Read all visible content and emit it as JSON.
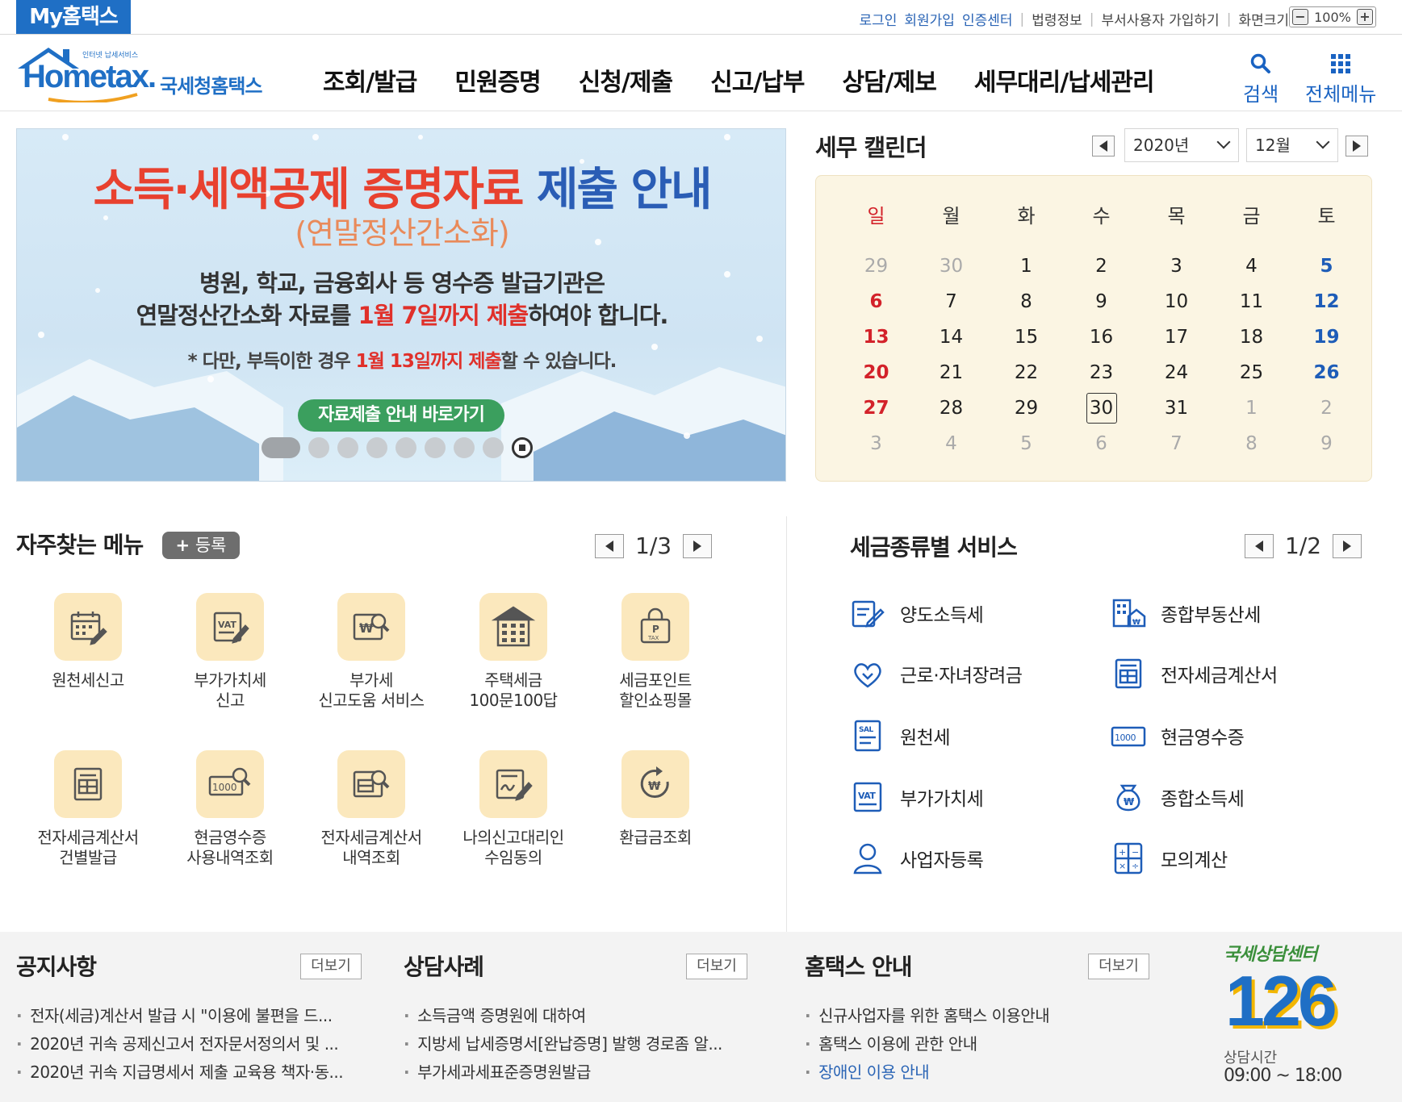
{
  "topbar": {
    "my_hometax": "My홈택스",
    "links": [
      {
        "label": "로그인",
        "style": "blue"
      },
      {
        "label": "회원가입",
        "style": "blue"
      },
      {
        "label": "인증센터",
        "style": "blue"
      },
      {
        "label": "법령정보",
        "style": "gray"
      },
      {
        "label": "부서사용자 가입하기",
        "style": "gray"
      },
      {
        "label": "화면크기",
        "style": "gray"
      }
    ],
    "zoom": "100%",
    "zoom_out": "−",
    "zoom_in": "+"
  },
  "header": {
    "logo_small": "인터넷 납세서비스",
    "logo_brand": "Hometax.",
    "logo_name": "국세청홈택스",
    "nav": [
      "조회/발급",
      "민원증명",
      "신청/제출",
      "신고/납부",
      "상담/제보",
      "세무대리/납세관리"
    ],
    "search_label": "검색",
    "allmenu_label": "전체메뉴"
  },
  "banner": {
    "title_red": "소득·세액공제 증명자료",
    "title_blue": "제출 안내",
    "subtitle": "(연말정산간소화)",
    "line1": "병원, 학교, 금융회사 등 영수증 발급기관은",
    "line2_a": "연말정산간소화 자료를 ",
    "line2_b": "1월 7일까지 제출",
    "line2_c": "하여야 합니다.",
    "note_a": "* 다만, 부득이한 경우 ",
    "note_b": "1월 13일까지 제출",
    "note_c": "할 수 있습니다.",
    "button": "자료제출 안내 바로가기"
  },
  "calendar": {
    "title": "세무 캘린더",
    "year": "2020년",
    "month": "12월",
    "weekdays": [
      "일",
      "월",
      "화",
      "수",
      "목",
      "금",
      "토"
    ],
    "weeks": [
      [
        "29",
        "30",
        "1",
        "2",
        "3",
        "4",
        "5"
      ],
      [
        "6",
        "7",
        "8",
        "9",
        "10",
        "11",
        "12"
      ],
      [
        "13",
        "14",
        "15",
        "16",
        "17",
        "18",
        "19"
      ],
      [
        "20",
        "21",
        "22",
        "23",
        "24",
        "25",
        "26"
      ],
      [
        "27",
        "28",
        "29",
        "30",
        "31",
        "1",
        "2"
      ],
      [
        "3",
        "4",
        "5",
        "6",
        "7",
        "8",
        "9"
      ]
    ],
    "today": "30"
  },
  "frequent": {
    "title": "자주찾는 메뉴",
    "add_label": "등록",
    "page": "1/3",
    "items": [
      {
        "label": "원천세신고",
        "icon": "calendar-edit-icon"
      },
      {
        "label": "부가가치세\n신고",
        "icon": "vat-form-icon"
      },
      {
        "label": "부가세\n신고도움 서비스",
        "icon": "won-search-icon"
      },
      {
        "label": "주택세금\n100문100답",
        "icon": "building-icon"
      },
      {
        "label": "세금포인트\n할인쇼핑몰",
        "icon": "shopping-bag-icon"
      },
      {
        "label": "전자세금계산서\n건별발급",
        "icon": "invoice-icon"
      },
      {
        "label": "현금영수증\n사용내역조회",
        "icon": "cash-receipt-search-icon"
      },
      {
        "label": "전자세금계산서\n내역조회",
        "icon": "invoice-search-icon"
      },
      {
        "label": "나의신고대리인\n수임동의",
        "icon": "sign-document-icon"
      },
      {
        "label": "환급금조회",
        "icon": "refund-icon"
      }
    ]
  },
  "tax_services": {
    "title": "세금종류별 서비스",
    "page": "1/2",
    "items": [
      {
        "label": "양도소득세",
        "icon": "transfer-tax-icon"
      },
      {
        "label": "종합부동산세",
        "icon": "real-estate-icon"
      },
      {
        "label": "근로·자녀장려금",
        "icon": "heart-hands-icon"
      },
      {
        "label": "전자세금계산서",
        "icon": "e-invoice-icon"
      },
      {
        "label": "원천세",
        "icon": "salary-icon"
      },
      {
        "label": "현금영수증",
        "icon": "cash-1000-icon"
      },
      {
        "label": "부가가치세",
        "icon": "vat-icon"
      },
      {
        "label": "종합소득세",
        "icon": "money-bag-icon"
      },
      {
        "label": "사업자등록",
        "icon": "person-icon"
      },
      {
        "label": "모의계산",
        "icon": "calculator-icon"
      }
    ]
  },
  "board": {
    "more_label": "더보기",
    "notice": {
      "title": "공지사항",
      "items": [
        "전자(세금)계산서 발급 시 \"이용에 불편을 드...",
        "2020년 귀속 공제신고서 전자문서정의서 및 ...",
        "2020년 귀속 지급명세서 제출 교육용 책자·동..."
      ]
    },
    "consult": {
      "title": "상담사례",
      "items": [
        "소득금액 증명원에 대하여",
        "지방세 납세증명서[완납증명] 발행 경로좀 알...",
        "부가세과세표준증명원발급"
      ]
    },
    "guide": {
      "title": "홈택스 안내",
      "items": [
        "신규사업자를 위한 홈택스 이용안내",
        "홈택스 이용에 관한 안내",
        "장애인 이용 안내"
      ]
    },
    "callcenter": {
      "title": "국세상담센터",
      "number": "126",
      "hours_label": "상담시간",
      "hours": "09:00 ~ 18:00"
    }
  }
}
